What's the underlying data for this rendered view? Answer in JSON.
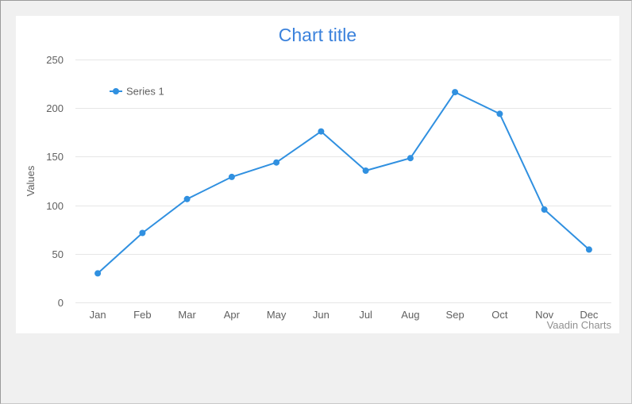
{
  "chart_data": {
    "type": "line",
    "title": "Chart title",
    "xlabel": "",
    "ylabel": "Values",
    "categories": [
      "Jan",
      "Feb",
      "Mar",
      "Apr",
      "May",
      "Jun",
      "Jul",
      "Aug",
      "Sep",
      "Oct",
      "Nov",
      "Dec"
    ],
    "series": [
      {
        "name": "Series 1",
        "values": [
          29.9,
          71.5,
          106.4,
          129.2,
          144.0,
          176.0,
          135.6,
          148.5,
          216.4,
          194.1,
          95.6,
          54.4
        ],
        "color": "#3090e0"
      }
    ],
    "yticks": [
      0,
      50,
      100,
      150,
      200,
      250
    ],
    "ylim": [
      0,
      250
    ],
    "grid": true,
    "legend": "top-left",
    "credits": "Vaadin Charts",
    "colors": {
      "title": "#3b82dc",
      "grid": "#e6e6e6",
      "axis_text": "#606060",
      "credits": "#909090"
    }
  }
}
